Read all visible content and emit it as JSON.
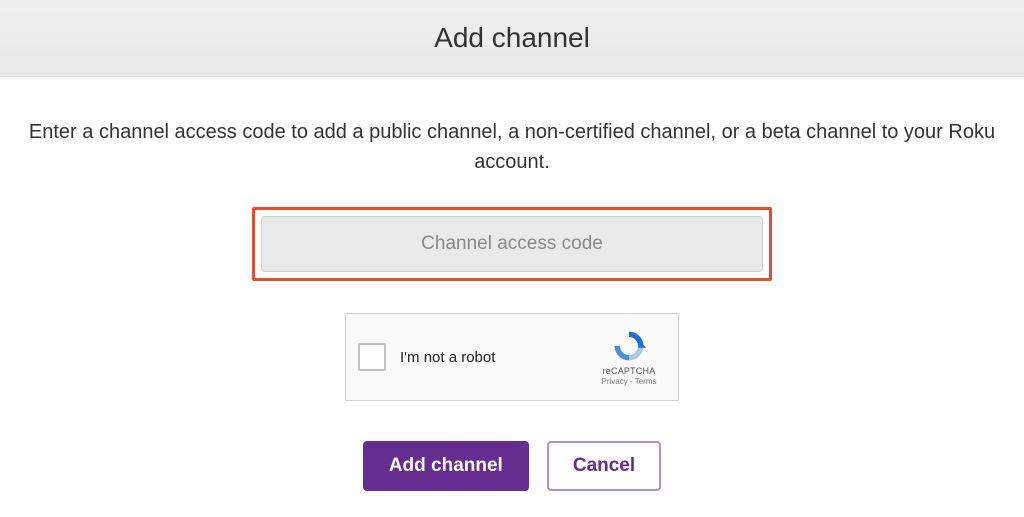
{
  "header": {
    "title": "Add channel"
  },
  "instruction": "Enter a channel access code to add a public channel, a non-certified channel, or a beta channel to your Roku account.",
  "input": {
    "placeholder": "Channel access code",
    "value": ""
  },
  "recaptcha": {
    "label": "I'm not a robot",
    "brand": "reCAPTCHA",
    "links": "Privacy - Terms"
  },
  "buttons": {
    "primary": "Add channel",
    "secondary": "Cancel"
  },
  "colors": {
    "accent": "#662d91",
    "highlight_border": "#e84c2f"
  }
}
